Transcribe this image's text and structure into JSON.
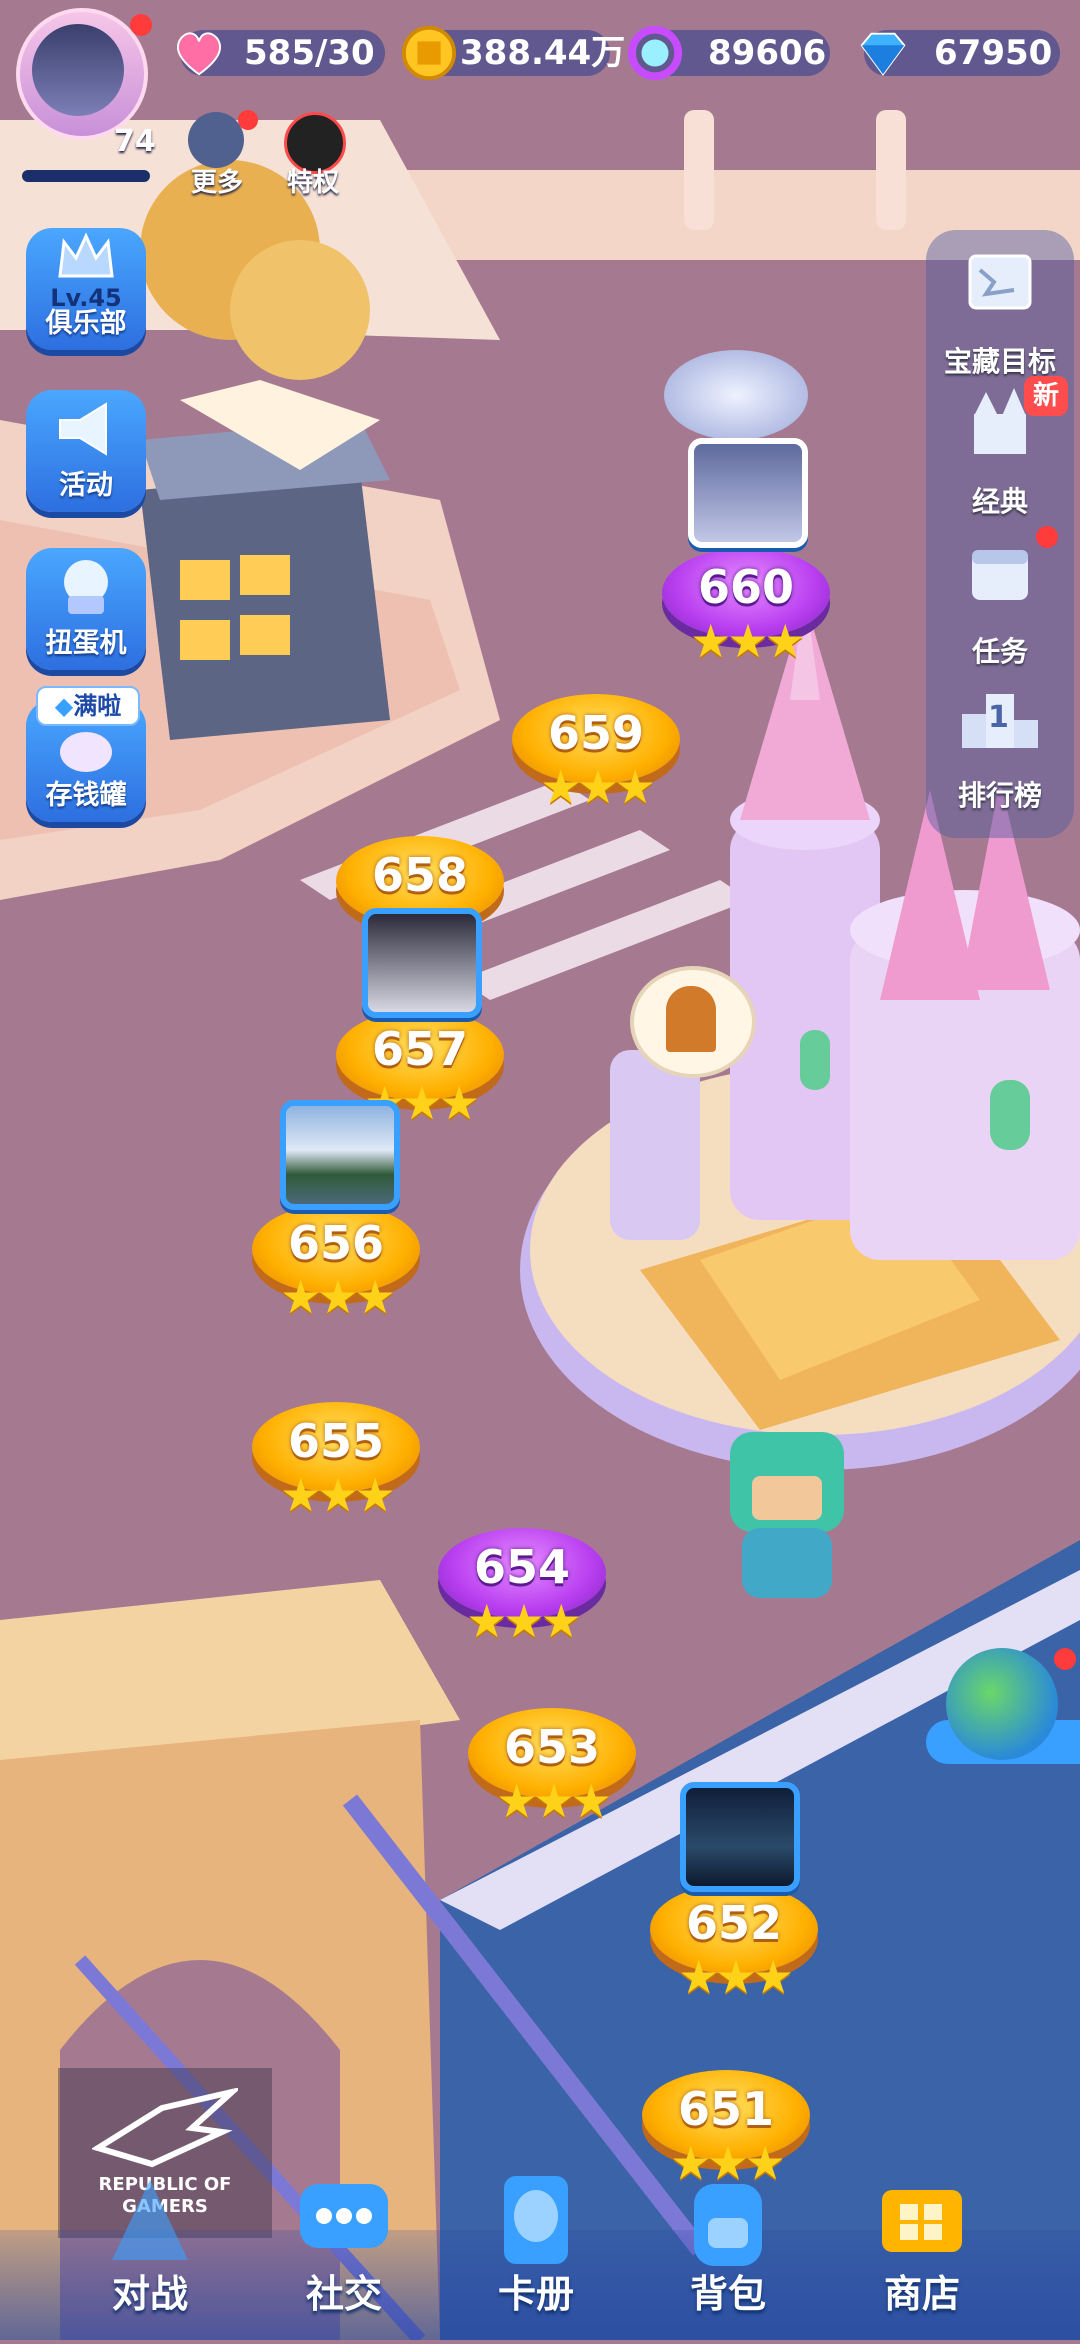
{
  "header": {
    "avatar_level": "74",
    "hearts": "585/30",
    "coins": "388.44万",
    "gems": "89606",
    "diamonds": "67950",
    "more_label": "更多",
    "privilege_label": "特权"
  },
  "left_menu": [
    {
      "top": "Lv.45",
      "label": "俱乐部",
      "icon": "crown-icon"
    },
    {
      "label": "活动",
      "icon": "megaphone-icon"
    },
    {
      "label": "扭蛋机",
      "icon": "gacha-machine-icon"
    },
    {
      "label": "存钱罐",
      "icon": "piggy-bank-icon",
      "badge": "满啦"
    }
  ],
  "right_menu": [
    {
      "label": "宝藏目标",
      "icon": "treasure-map-icon"
    },
    {
      "label": "经典",
      "icon": "castle-icon",
      "badge": "新"
    },
    {
      "label": "任务",
      "icon": "calendar-icon"
    },
    {
      "label": "排行榜",
      "icon": "podium-icon",
      "rank": "1"
    }
  ],
  "levels": [
    {
      "num": "660",
      "stars": "★★★",
      "style": "purple"
    },
    {
      "num": "659",
      "stars": "★★★",
      "style": "gold"
    },
    {
      "num": "658",
      "stars": "",
      "style": "gold"
    },
    {
      "num": "657",
      "stars": "★★★",
      "style": "gold"
    },
    {
      "num": "656",
      "stars": "★★★",
      "style": "gold"
    },
    {
      "num": "655",
      "stars": "★★★",
      "style": "gold"
    },
    {
      "num": "654",
      "stars": "★★★",
      "style": "purple"
    },
    {
      "num": "653",
      "stars": "★★★",
      "style": "gold"
    },
    {
      "num": "652",
      "stars": "★★★",
      "style": "gold"
    },
    {
      "num": "651",
      "stars": "★★★",
      "style": "gold"
    }
  ],
  "watermark": {
    "line1": "REPUBLIC OF",
    "line2": "GAMERS"
  },
  "bottom_tabs": [
    {
      "label": "对战",
      "icon": "battle-icon"
    },
    {
      "label": "社交",
      "icon": "chat-bubble-icon"
    },
    {
      "label": "卡册",
      "icon": "card-album-icon"
    },
    {
      "label": "背包",
      "icon": "backpack-icon"
    },
    {
      "label": "商店",
      "icon": "shop-cart-icon"
    }
  ],
  "colors": {
    "accent": "#3aa0ff",
    "gold": "#ffb000",
    "purple": "#b83ef0",
    "road": "#a57a90"
  }
}
